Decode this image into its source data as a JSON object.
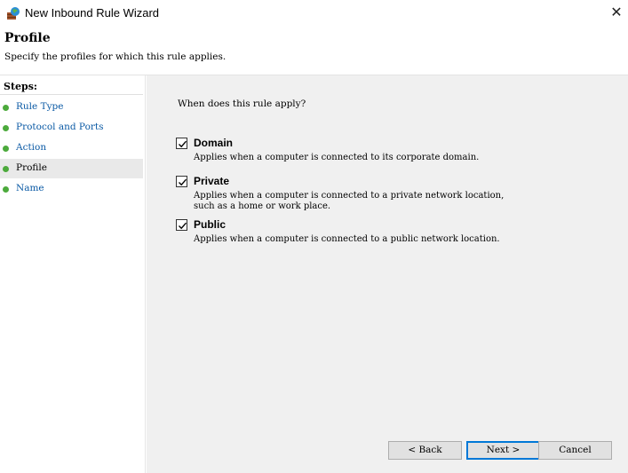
{
  "window": {
    "title": "New Inbound Rule Wizard",
    "close_glyph": "✕"
  },
  "header": {
    "title": "Profile",
    "subtitle": "Specify the profiles for which this rule applies."
  },
  "steps": {
    "title": "Steps:",
    "items": [
      {
        "label": "Rule Type",
        "active": false
      },
      {
        "label": "Protocol and Ports",
        "active": false
      },
      {
        "label": "Action",
        "active": false
      },
      {
        "label": "Profile",
        "active": true
      },
      {
        "label": "Name",
        "active": false
      }
    ]
  },
  "content": {
    "question": "When does this rule apply?",
    "options": [
      {
        "label": "Domain",
        "checked": true,
        "description": "Applies when a computer is connected to its corporate domain."
      },
      {
        "label": "Private",
        "checked": true,
        "description": "Applies when a computer is connected to a private network location,\nsuch as a home or work place."
      },
      {
        "label": "Public",
        "checked": true,
        "description": "Applies when a computer is connected to a public network location."
      }
    ]
  },
  "buttons": {
    "back": "< Back",
    "next": "Next >",
    "cancel": "Cancel"
  },
  "colors": {
    "step_dot": "#4caa3c",
    "step_link": "#0b5aa5",
    "content_bg": "#f0f0f0",
    "focus_border": "#0078d7"
  }
}
